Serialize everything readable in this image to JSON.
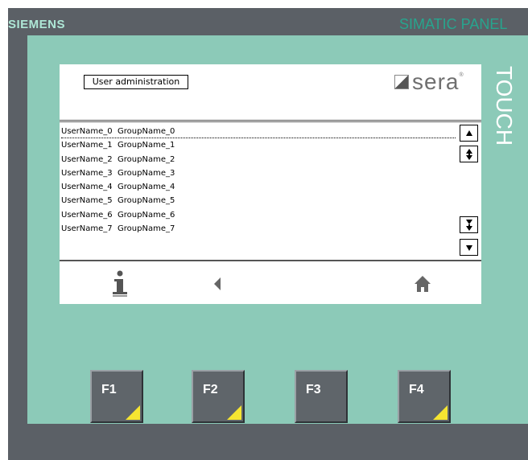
{
  "device": {
    "brand": "SIEMENS",
    "model": "SIMATIC PANEL",
    "touch_label": "TOUCH"
  },
  "screen": {
    "title": "User administration",
    "logo_text": "sera",
    "logo_registered": "®"
  },
  "users": [
    {
      "user": "UserName_0",
      "group": "GroupName_0"
    },
    {
      "user": "UserName_1",
      "group": "GroupName_1"
    },
    {
      "user": "UserName_2",
      "group": "GroupName_2"
    },
    {
      "user": "UserName_3",
      "group": "GroupName_3"
    },
    {
      "user": "UserName_4",
      "group": "GroupName_4"
    },
    {
      "user": "UserName_5",
      "group": "GroupName_5"
    },
    {
      "user": "UserName_6",
      "group": "GroupName_6"
    },
    {
      "user": "UserName_7",
      "group": "GroupName_7"
    }
  ],
  "scroll_icons": [
    "arrow-up-icon",
    "page-up-icon",
    "page-down-icon",
    "arrow-down-icon"
  ],
  "nav_icons": [
    "info-icon",
    "back-arrow-icon",
    "home-icon"
  ],
  "function_keys": [
    "F1",
    "F2",
    "F3",
    "F4"
  ],
  "colors": {
    "brand_text": "#aee7d6",
    "model_text": "#27a58e",
    "bezel": "#8ccab8",
    "device_body": "#5b6066",
    "fkey_body": "#5f656a",
    "fkey_accent": "#f6e531"
  }
}
